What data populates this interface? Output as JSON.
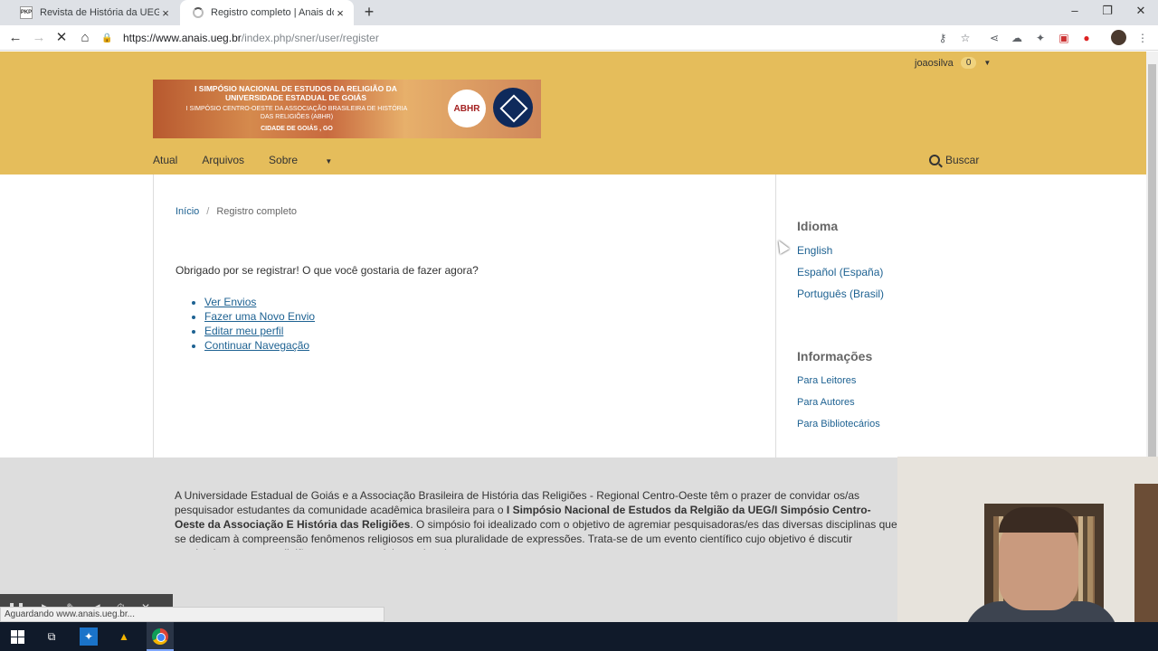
{
  "browser": {
    "tabs": [
      {
        "title": "Revista de História da UEG (ISSN",
        "favicon": "PKP"
      },
      {
        "title": "Registro completo | Anais do Sim",
        "favicon": "loading-spinner"
      }
    ],
    "url_host": "https://www.anais.ueg.br",
    "url_path": "/index.php/sner/user/register",
    "status_text": "Aguardando www.anais.ueg.br..."
  },
  "header": {
    "username": "joaosilva",
    "notifications": "0",
    "banner": {
      "line1": "I SIMPÓSIO NACIONAL DE ESTUDOS DA RELIGIÃO DA UNIVERSIDADE ESTADUAL DE GOIÁS",
      "line2": "I SIMPÓSIO CENTRO-OESTE DA ASSOCIAÇÃO BRASILEIRA DE HISTÓRIA DAS RELIGIÕES (ABHR)",
      "line3": "CIDADE DE GOIÁS , GO",
      "logo_text": "ABHR"
    },
    "nav": [
      "Atual",
      "Arquivos",
      "Sobre"
    ],
    "search_label": "Buscar"
  },
  "content": {
    "breadcrumb_home": "Início",
    "breadcrumb_current": "Registro completo",
    "thanks": "Obrigado por se registrar! O que você gostaria de fazer agora?",
    "actions": [
      "Ver Envios",
      "Fazer uma Novo Envio",
      "Editar meu perfil",
      "Continuar Navegação"
    ]
  },
  "sidebar": {
    "language_title": "Idioma",
    "languages": [
      "English",
      "Español (España)",
      "Português (Brasil)"
    ],
    "info_title": "Informações",
    "info_links": [
      "Para Leitores",
      "Para Autores",
      "Para Bibliotecários"
    ]
  },
  "footer": {
    "text_a": "A Universidade Estadual de Goiás e a Associação Brasileira de História das Religiões - Regional Centro-Oeste têm o prazer de convidar os/as pesquisador estudantes da comunidade acadêmica brasileira para o ",
    "text_bold": "I Simpósio Nacional de Estudos da Relgião da UEG/I Simpósio Centro-Oeste da Associação E História das Religiões",
    "text_b": ". O simpósio foi idealizado com o objetivo de agremiar pesquisadoras/es das diversas disciplinas que se dedicam à compreensão fenômenos religiosos em sua pluralidade de expressões. Trata-se de um evento científico cujo objetivo é discutir academicamente as religiões enquanto sociais e culturais."
  },
  "colors": {
    "header_bg": "#e5bd5b",
    "link": "#1e6292",
    "footer_bg": "#dddddd",
    "taskbar_bg": "#101a2a"
  }
}
